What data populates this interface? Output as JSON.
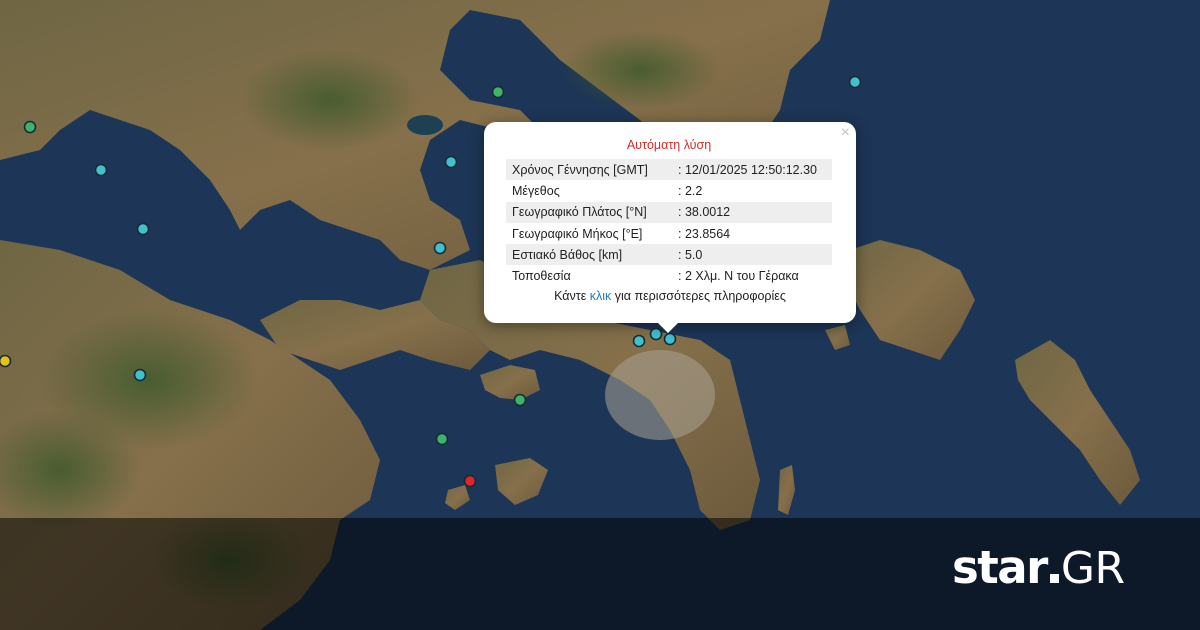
{
  "popup": {
    "title": "Αυτόματη λύση",
    "close_symbol": "×",
    "rows": [
      {
        "label": "Χρόνος Γέννησης [GMT]",
        "value": ": 12/01/2025 12:50:12.30"
      },
      {
        "label": "Μέγεθος",
        "value": ": 2.2"
      },
      {
        "label": "Γεωγραφικό Πλάτος [°N]",
        "value": ": 38.0012"
      },
      {
        "label": "Γεωγραφικό Μήκος [°E]",
        "value": ": 23.8564"
      },
      {
        "label": "Εστιακό Βάθος [km]",
        "value": ": 5.0"
      },
      {
        "label": "Τοποθεσία",
        "value": ": 2 Χλμ. Ν του Γέρακα"
      }
    ],
    "more_prefix": "Κάντε ",
    "more_link": "κλικ",
    "more_suffix": " για περισσότερες πληροφορίες"
  },
  "brand": {
    "name": "star",
    "suffix": "GR"
  },
  "colors": {
    "sea": "#1d3556",
    "land": "#7a6a47",
    "marker_cyan": "#3fc1cf",
    "marker_green": "#3db36b",
    "marker_red": "#e0262a",
    "marker_yellow": "#e6c21d",
    "popup_title": "#c9302c",
    "link": "#1e7bc4"
  }
}
